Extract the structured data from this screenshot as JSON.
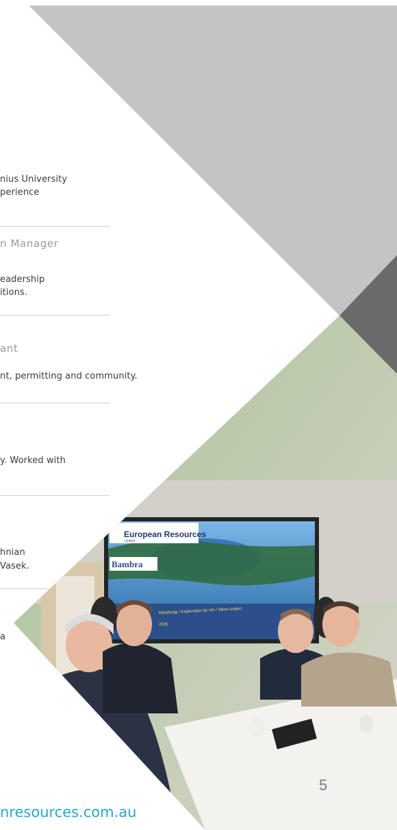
{
  "text_fragments": {
    "line1": "nius University",
    "line2": "perience",
    "role1": "n Manager",
    "line3": "eadership",
    "line4": "itions.",
    "role2": "ant",
    "line5": "nt, permitting and community.",
    "line6": "y. Worked with",
    "line7": "hnian",
    "line8": "Vasek.",
    "line9": "a"
  },
  "photo": {
    "screen_logo": "European Resources",
    "screen_logo_sub": "Limited",
    "screen_brand": "Bambra",
    "screen_caption_1": "Metallurgy / Exploration for HH / Silver project",
    "screen_caption_2": "2025"
  },
  "footer": {
    "website": "nresources.com.au",
    "page_number": "5"
  },
  "colors": {
    "light_grey_band": "#c4c4c4",
    "dark_grey_band": "#6a6a6a",
    "accent_cyan": "#2aa6c8"
  }
}
